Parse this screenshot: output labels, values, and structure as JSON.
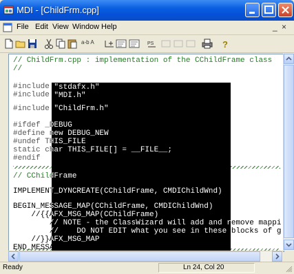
{
  "window": {
    "title": "MDI - [ChildFrm.cpp]"
  },
  "menu": {
    "items": [
      "File",
      "Edit",
      "View",
      "Window",
      "Help"
    ],
    "mdi_min": "_",
    "mdi_restore": "×"
  },
  "toolbar": {
    "find_label": "a-b A",
    "tag1": "PS\n└→",
    "icons": [
      "new-file-icon",
      "open-folder-icon",
      "save-icon",
      "cut-icon",
      "copy-icon",
      "paste-icon",
      "find-replace-icon",
      "font-icon",
      "insert-icon",
      "list-icon",
      "wrap-icon",
      "print-icon",
      "help-icon"
    ]
  },
  "editor": {
    "lines": [
      {
        "text": "// ChildFrm.cpp : implementation of the CChildFrame class",
        "kind": "comment"
      },
      {
        "text": "//",
        "kind": "comment"
      },
      {
        "text": "#include \"stdafx.h\"",
        "kind": "code"
      },
      {
        "text": "#include \"MDI.h\"",
        "kind": "code"
      },
      {
        "text": "#include \"ChildFrm.h\"",
        "kind": "code"
      },
      {
        "text": "#ifdef _DEBUG",
        "kind": "code"
      },
      {
        "text": "#define new DEBUG_NEW",
        "kind": "code"
      },
      {
        "text": "#undef THIS_FILE",
        "kind": "code"
      },
      {
        "text": "static char THIS_FILE[] = __FILE__;",
        "kind": "code"
      },
      {
        "text": "#endif",
        "kind": "code"
      },
      {
        "text": "// CChildFrame",
        "kind": "comment"
      },
      {
        "text": "IMPLEMENT_DYNCREATE(CChildFrame, CMDIChildWnd)",
        "kind": "code"
      },
      {
        "text": "BEGIN_MESSAGE_MAP(CChildFrame, CMDIChildWnd)",
        "kind": "code"
      },
      {
        "text": "    //{{AFX_MSG_MAP(CChildFrame)",
        "kind": "code"
      },
      {
        "text": "        // NOTE - the ClassWizard will add and remove mappi",
        "kind": "code"
      },
      {
        "text": "        //    DO NOT EDIT what you see in these blocks of g",
        "kind": "code"
      },
      {
        "text": "    //}}AFX_MSG_MAP",
        "kind": "code"
      },
      {
        "text": "END_MESSAGE_MAP()",
        "kind": "code"
      }
    ]
  },
  "status": {
    "left": "Ready",
    "position": "Ln 24, Col 20"
  },
  "colors": {
    "titlebar": "#0a5fe0",
    "comment": "#2b7a2b",
    "overlay": "#000000"
  }
}
